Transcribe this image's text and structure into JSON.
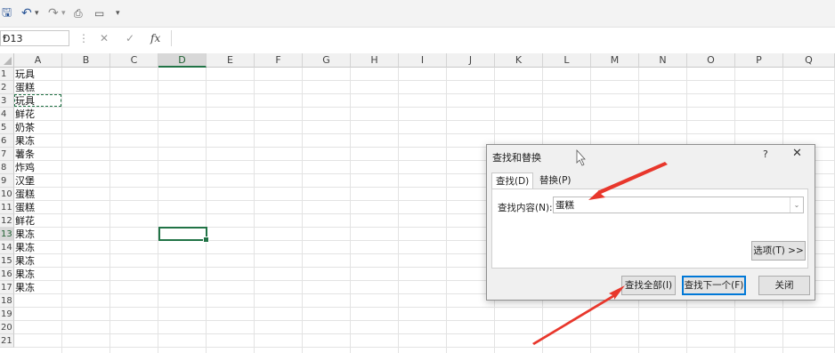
{
  "quick_access": {
    "icons": [
      "save-icon",
      "undo-icon",
      "redo-icon",
      "print-preview-icon",
      "touch-mode-icon",
      "customize-qat-icon"
    ],
    "glyphs": {
      "save": "🖫",
      "undo": "↶",
      "undo_dd": "▾",
      "redo": "↷",
      "redo_dd": "▾",
      "preview": "⎙",
      "touch": "▭",
      "customize": "▾"
    }
  },
  "formula_bar": {
    "name_box": "D13",
    "name_box_dropdown": "▾",
    "separator": "⋮",
    "cancel": "✕",
    "enter": "✓",
    "fx": "fx",
    "formula": ""
  },
  "sheet": {
    "columns": [
      "A",
      "B",
      "C",
      "D",
      "E",
      "F",
      "G",
      "H",
      "I",
      "J",
      "K",
      "L",
      "M",
      "N",
      "O",
      "P",
      "Q"
    ],
    "selected_column": "D",
    "rows": [
      "1",
      "2",
      "3",
      "4",
      "5",
      "6",
      "7",
      "8",
      "9",
      "10",
      "11",
      "12",
      "13",
      "14",
      "15",
      "16",
      "17",
      "18",
      "19",
      "20",
      "21"
    ],
    "selected_row": "13",
    "column_a_values": [
      "玩具",
      "蛋糕",
      "玩具",
      "鲜花",
      "奶茶",
      "果冻",
      "薯条",
      "炸鸡",
      "汉堡",
      "蛋糕",
      "蛋糕",
      "鲜花",
      "果冻",
      "果冻",
      "果冻",
      "果冻",
      "果冻"
    ]
  },
  "dialog": {
    "title": "查找和替换",
    "help": "?",
    "close": "✕",
    "tabs": {
      "find": "查找(D)",
      "replace": "替换(P)"
    },
    "find_label": "查找内容(N):",
    "find_value": "蛋糕",
    "dropdown": "⌄",
    "options_button": "选项(T) >>",
    "find_all_button": "查找全部(I)",
    "find_next_button": "查找下一个(F)",
    "close_button": "关闭"
  },
  "colors": {
    "excel_green": "#217346",
    "annotation_red": "#e8372c",
    "dialog_bg": "#f0f0f0"
  }
}
